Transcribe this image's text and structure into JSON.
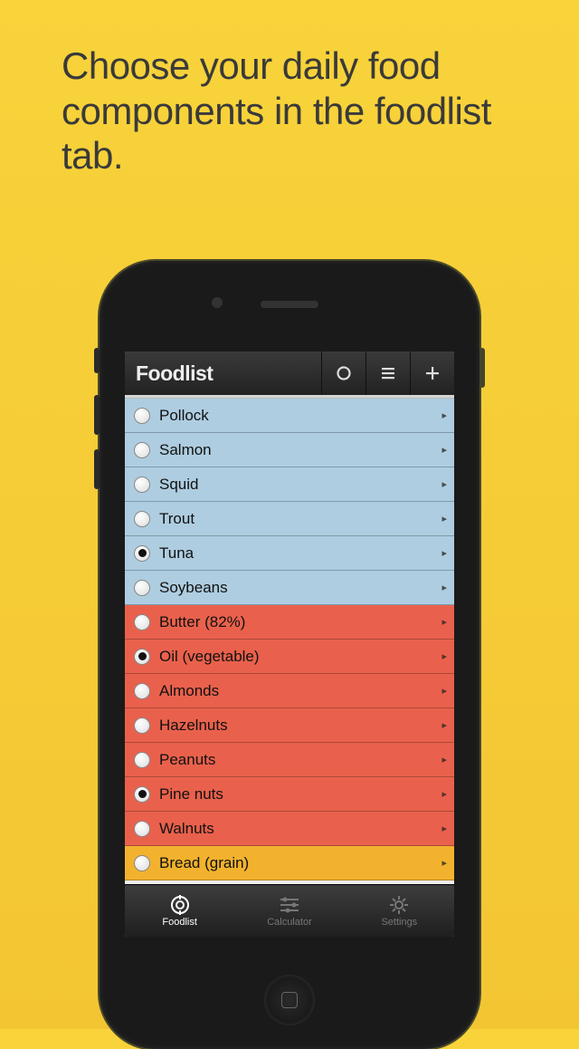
{
  "promo_text": "Choose your daily food components in the foodlist tab.",
  "header": {
    "title": "Foodlist"
  },
  "rows": [
    {
      "label": "Pollock",
      "selected": false,
      "category": "blue"
    },
    {
      "label": "Salmon",
      "selected": false,
      "category": "blue"
    },
    {
      "label": "Squid",
      "selected": false,
      "category": "blue"
    },
    {
      "label": "Trout",
      "selected": false,
      "category": "blue"
    },
    {
      "label": "Tuna",
      "selected": true,
      "category": "blue"
    },
    {
      "label": "Soybeans",
      "selected": false,
      "category": "blue"
    },
    {
      "label": "Butter (82%)",
      "selected": false,
      "category": "red"
    },
    {
      "label": "Oil (vegetable)",
      "selected": true,
      "category": "red"
    },
    {
      "label": "Almonds",
      "selected": false,
      "category": "red"
    },
    {
      "label": "Hazelnuts",
      "selected": false,
      "category": "red"
    },
    {
      "label": "Peanuts",
      "selected": false,
      "category": "red"
    },
    {
      "label": "Pine nuts",
      "selected": true,
      "category": "red"
    },
    {
      "label": "Walnuts",
      "selected": false,
      "category": "red"
    },
    {
      "label": "Bread (grain)",
      "selected": false,
      "category": "yellow"
    }
  ],
  "tabs": [
    {
      "label": "Foodlist",
      "active": true
    },
    {
      "label": "Calculator",
      "active": false
    },
    {
      "label": "Settings",
      "active": false
    }
  ]
}
